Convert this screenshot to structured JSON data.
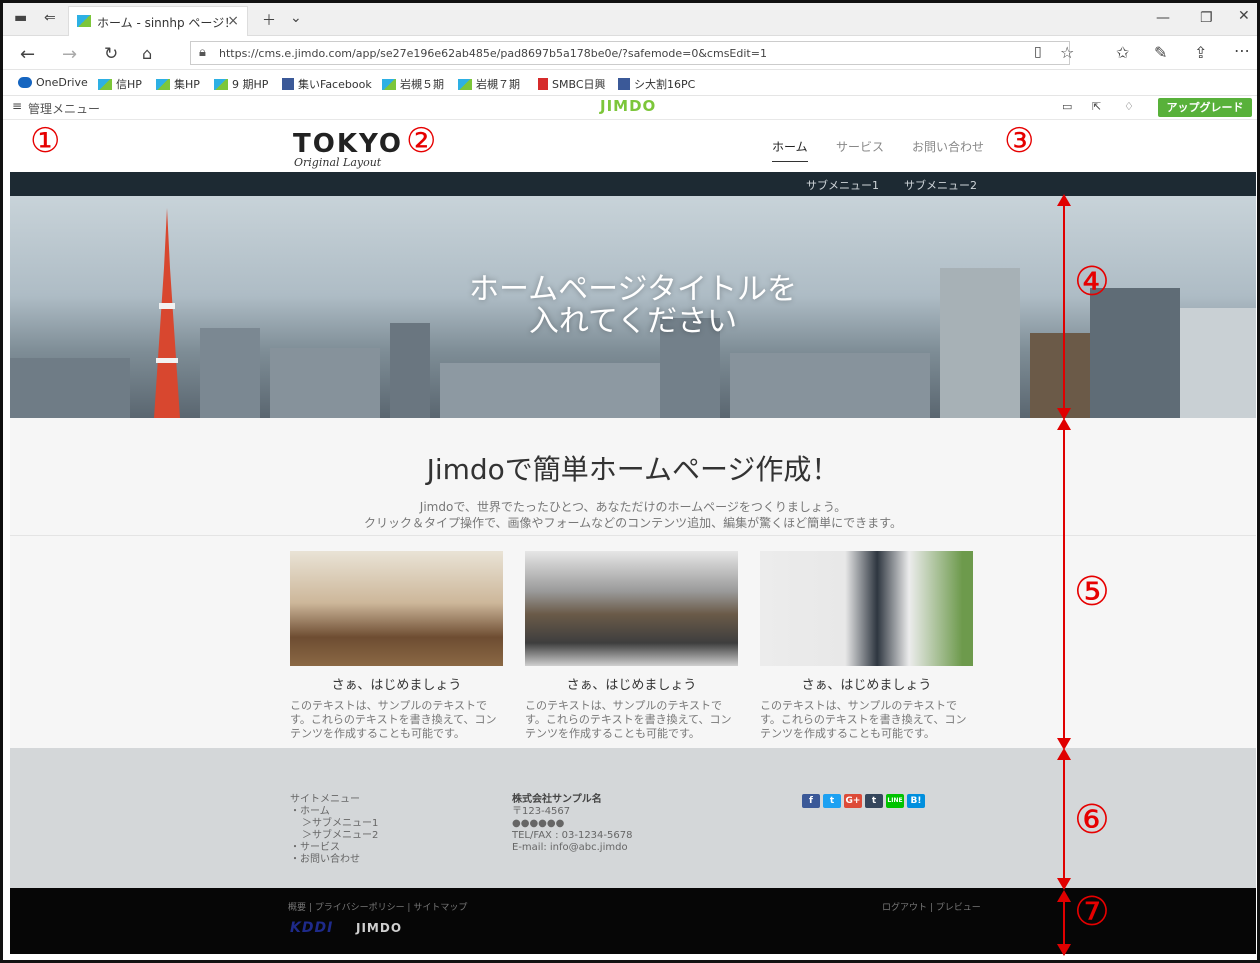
{
  "browser": {
    "tab_title": "ホーム - sinnhp ページ！",
    "url": "https://cms.e.jimdo.com/app/se27e196e62ab485e/pad8697b5a178be0e/?safemode=0&cmsEdit=1",
    "favorites": [
      "OneDrive",
      "信HP",
      "集HP",
      "9 期HP",
      "集いFacebook",
      "岩槻５期",
      "岩槻７期",
      "SMBC日興",
      "シ大割16PC"
    ]
  },
  "adminbar": {
    "menu_label": "管理メニュー",
    "logo": "JIMDO",
    "upgrade_label": "アップグレード"
  },
  "header": {
    "logo_main": "TOKYO",
    "logo_sub": "Original Layout",
    "nav": [
      "ホーム",
      "サービス",
      "お問い合わせ"
    ],
    "subnav": [
      "サブメニュー1",
      "サブメニュー2"
    ]
  },
  "hero": {
    "title_line1": "ホームページタイトルを",
    "title_line2": "入れてください"
  },
  "intro": {
    "heading": "Jimdoで簡単ホームページ作成！",
    "line1": "Jimdoで、世界でたったひとつ、あなただけのホームページをつくりましょう。",
    "line2": "クリック＆タイプ操作で、画像やフォームなどのコンテンツ追加、編集が驚くほど簡単にできます。"
  },
  "cards": [
    {
      "title": "さぁ、はじめましょう",
      "text": "このテキストは、サンプルのテキストです。これらのテキストを書き換えて、コンテンツを作成することも可能です。"
    },
    {
      "title": "さぁ、はじめましょう",
      "text": "このテキストは、サンプルのテキストです。これらのテキストを書き換えて、コンテンツを作成することも可能です。"
    },
    {
      "title": "さぁ、はじめましょう",
      "text": "このテキストは、サンプルのテキストです。これらのテキストを書き換えて、コンテンツを作成することも可能です。"
    }
  ],
  "footer": {
    "sitemenu_title": "サイトメニュー",
    "sitemenu": [
      "・ホーム",
      "＞サブメニュー1",
      "＞サブメニュー2",
      "・サービス",
      "・お問い合わせ"
    ],
    "company": "株式会社サンプル名",
    "postal": "〒123-4567",
    "address": "●●●●●●",
    "tel": "TEL/FAX : 03-1234-5678",
    "email": "E-mail: info@abc.jimdo",
    "social": [
      "f",
      "t",
      "G+",
      "t",
      "LINE",
      "B!"
    ]
  },
  "bottombar": {
    "links": "概要 | プライバシーポリシー | サイトマップ",
    "right": "ログアウト | プレビュー",
    "kddi": "KDDI",
    "jimdo": "JIMDO"
  },
  "markers": [
    "①",
    "②",
    "③",
    "④",
    "⑤",
    "⑥",
    "⑦"
  ],
  "colors": {
    "accent_red": "#e60000",
    "upgrade_green": "#58b13a",
    "subnav_bg": "#1d2a33"
  }
}
